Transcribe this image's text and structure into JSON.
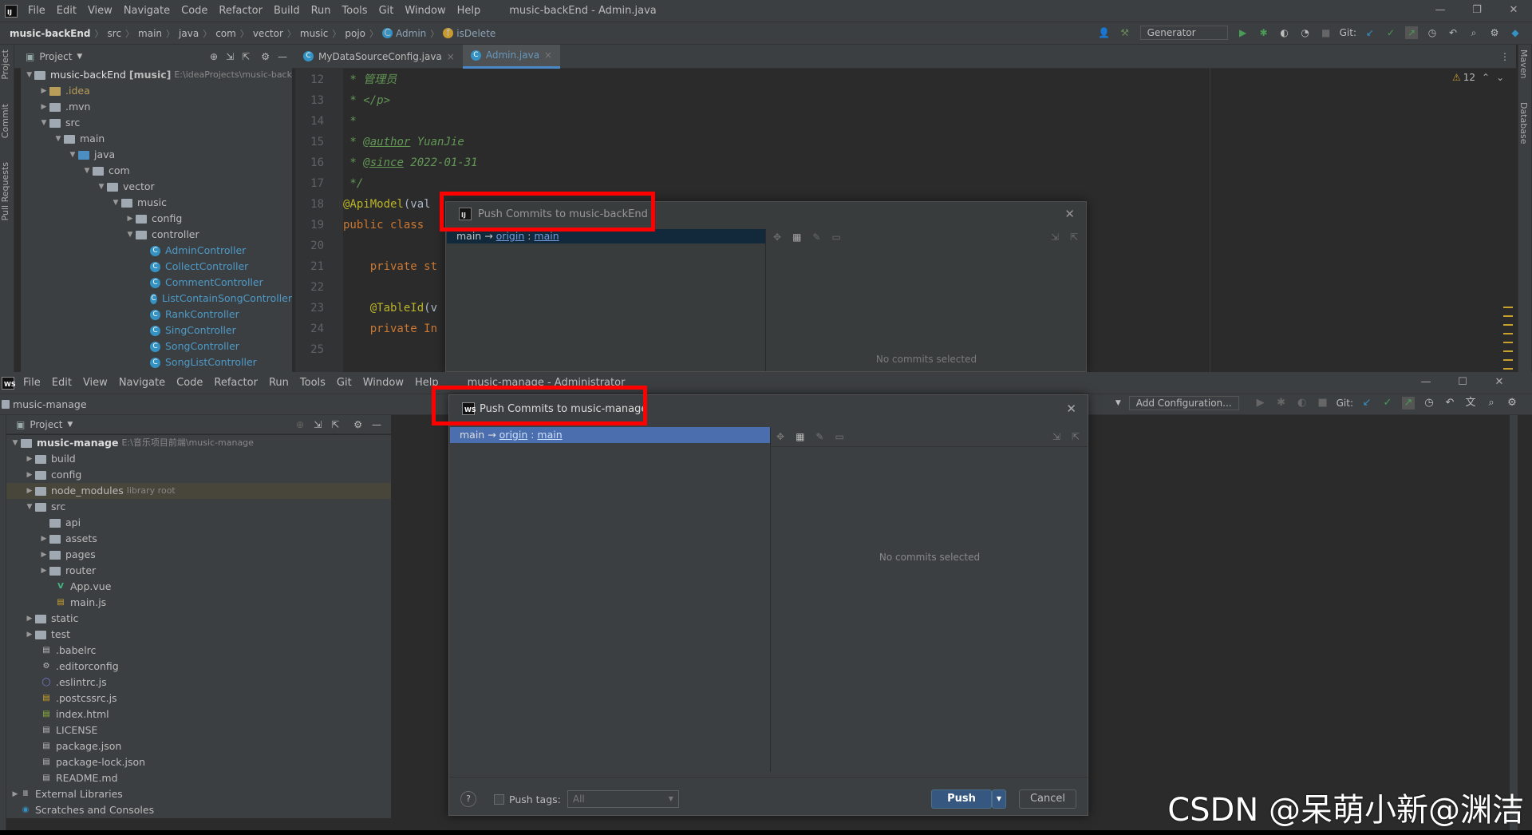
{
  "win1": {
    "menu": [
      "File",
      "Edit",
      "View",
      "Navigate",
      "Code",
      "Refactor",
      "Build",
      "Run",
      "Tools",
      "Git",
      "Window",
      "Help"
    ],
    "title": "music-backEnd - Admin.java",
    "breadcrumb": [
      "music-backEnd",
      "src",
      "main",
      "java",
      "com",
      "vector",
      "music",
      "pojo",
      "Admin",
      "isDelete"
    ],
    "run_config": "Generator",
    "git_label": "Git:",
    "project_label": "Project",
    "tabs": [
      "MyDataSourceConfig.java",
      "Admin.java"
    ],
    "warnings": "12",
    "side_tabs": [
      "Project",
      "Commit",
      "Pull Requests"
    ],
    "right_tabs": [
      "Maven",
      "Database"
    ],
    "tree": [
      {
        "label": "music-backEnd",
        "bold": "[music]",
        "path": "E:\\ideaProjects\\music-back"
      },
      {
        "label": ".idea"
      },
      {
        "label": ".mvn"
      },
      {
        "label": "src"
      },
      {
        "label": "main"
      },
      {
        "label": "java"
      },
      {
        "label": "com"
      },
      {
        "label": "vector"
      },
      {
        "label": "music"
      },
      {
        "label": "config"
      },
      {
        "label": "controller"
      },
      {
        "label": "AdminController"
      },
      {
        "label": "CollectController"
      },
      {
        "label": "CommentController"
      },
      {
        "label": "ListContainSongController"
      },
      {
        "label": "RankController"
      },
      {
        "label": "SingController"
      },
      {
        "label": "SongController"
      },
      {
        "label": "SongListController"
      }
    ],
    "code": {
      "lines": [
        "12",
        "13",
        "14",
        "15",
        "16",
        "17",
        "18",
        "19",
        "20",
        "21",
        "22",
        "23",
        "24",
        "25"
      ],
      "l12": " * 管理员",
      "l13a": " * ",
      "l13b": "</p>",
      "l14": " *",
      "l15a": " * ",
      "l15b": "@author",
      "l15c": " YuanJie",
      "l16a": " * ",
      "l16b": "@since",
      "l16c": " 2022-01-31",
      "l17": " */",
      "l18a": "@ApiModel",
      "l18b": "(val",
      "l19a": "public class ",
      "l21a": "    private st",
      "l23a": "    @TableId",
      "l23b": "(v",
      "l24a": "    private In"
    }
  },
  "dlg1": {
    "title": "Push Commits to music-backEnd",
    "branch_prefix": "main → ",
    "remote": "origin",
    "sep": " : ",
    "target": "main",
    "empty": "No commits selected"
  },
  "win2": {
    "menu": [
      "File",
      "Edit",
      "View",
      "Navigate",
      "Code",
      "Refactor",
      "Run",
      "Tools",
      "Git",
      "Window",
      "Help"
    ],
    "title": "music-manage - Administrator",
    "project_name": "music-manage",
    "project_label": "Project",
    "add_config": "Add Configuration...",
    "git_label": "Git:",
    "tree": [
      {
        "label": "music-manage",
        "path": "E:\\音乐项目前端\\music-manage"
      },
      {
        "label": "build"
      },
      {
        "label": "config"
      },
      {
        "label": "node_modules",
        "hint": "library root"
      },
      {
        "label": "src"
      },
      {
        "label": "api"
      },
      {
        "label": "assets"
      },
      {
        "label": "pages"
      },
      {
        "label": "router"
      },
      {
        "label": "App.vue"
      },
      {
        "label": "main.js"
      },
      {
        "label": "static"
      },
      {
        "label": "test"
      },
      {
        "label": ".babelrc"
      },
      {
        "label": ".editorconfig"
      },
      {
        "label": ".eslintrc.js"
      },
      {
        "label": ".postcssrc.js"
      },
      {
        "label": "index.html"
      },
      {
        "label": "LICENSE"
      },
      {
        "label": "package.json"
      },
      {
        "label": "package-lock.json"
      },
      {
        "label": "README.md"
      },
      {
        "label": "External Libraries"
      },
      {
        "label": "Scratches and Consoles"
      }
    ]
  },
  "dlg2": {
    "title": "Push Commits to music-manage",
    "branch_prefix": "main → ",
    "remote": "origin",
    "sep": " : ",
    "target": "main",
    "empty": "No commits selected",
    "help": "?",
    "push_tags": "Push tags:",
    "tags_value": "All",
    "push": "Push",
    "cancel": "Cancel"
  },
  "watermark": "CSDN @呆萌小新@渊洁",
  "colors": {
    "highlight_box": "#ff0000",
    "primary_button": "#365880",
    "selected_row": "#4b6eaf"
  }
}
